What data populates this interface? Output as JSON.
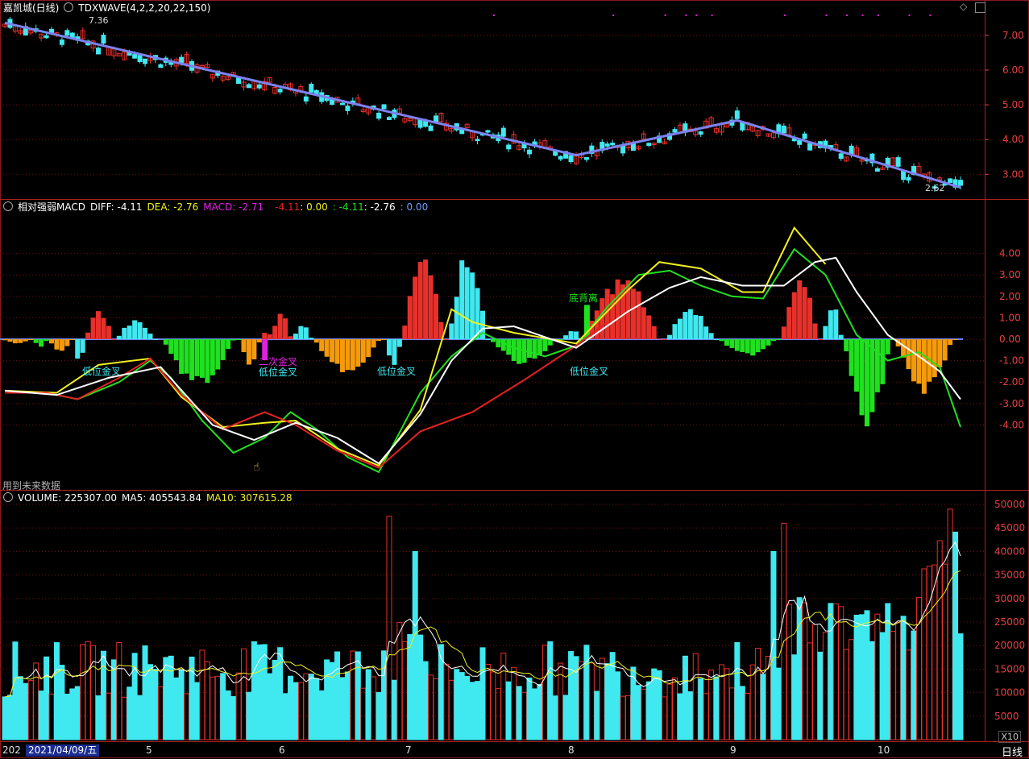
{
  "colors": {
    "up": "#e8302a",
    "down": "#40e8f0",
    "wave": "#7c82f0",
    "grid": "#7a1010",
    "diff_red": "#e82020",
    "dea_white": "#ffffff",
    "yellow": "#f0f020",
    "green": "#20e020",
    "orange": "#f59a0a",
    "magenta": "#e020e0",
    "axis_text": "#e84040"
  },
  "price_panel": {
    "title": "嘉凯城(日线)",
    "indicator": "TDXWAVE(4,2,2,20,22,150)",
    "high_label": "7.36",
    "low_label": "2.62",
    "y_ticks": [
      "7.00",
      "6.00",
      "5.00",
      "4.00",
      "3.00"
    ]
  },
  "macd_panel": {
    "title": "相对强弱MACD",
    "diff_label": "DIFF: -4.11",
    "dea_label": "DEA: -2.76",
    "macd_label": "MACD: -2.71",
    "v1": "-4.11",
    "v2": ": 0.00",
    "v3": ": -4.11",
    "v4": ": -2.76",
    "v5": ": 0.00",
    "y_ticks": [
      "4.00",
      "3.00",
      "2.00",
      "1.00",
      "0.00",
      "-1.00",
      "-2.00",
      "-3.00",
      "-4.00"
    ],
    "annotations": [
      "低位金叉",
      "二次金叉",
      "低位金叉",
      "低位金叉",
      "底背离",
      "低位金叉"
    ],
    "note": "用到未来数据"
  },
  "volume_panel": {
    "title": "VOLUME: 225307.00",
    "ma5": "MA5: 405543.84",
    "ma10": "MA10: 307615.28",
    "y_ticks": [
      "50000",
      "45000",
      "40000",
      "35000",
      "30000",
      "25000",
      "20000",
      "15000",
      "10000",
      "5000"
    ],
    "unit": "X10"
  },
  "xaxis": {
    "first": "202",
    "cursor_date": "2021/04/09/五",
    "months": [
      "5",
      "6",
      "7",
      "8",
      "9",
      "10"
    ],
    "period": "日线"
  },
  "chart_data": [
    {
      "type": "candlestick",
      "title": "嘉凯城(日线)",
      "ylim": [
        2.5,
        7.5
      ],
      "wave_points": [
        [
          0,
          7.36
        ],
        [
          110,
          3.55
        ],
        [
          141,
          4.55
        ],
        [
          184,
          2.62
        ]
      ],
      "note": "Daily price, approx. 185 sessions Apr–Oct 2021; descending from 7.36 to 2.62"
    },
    {
      "type": "bar",
      "title": "相对强弱MACD",
      "ylim": [
        -4.6,
        5.2
      ],
      "diff": -4.11,
      "dea": -2.76,
      "macd": -2.71
    },
    {
      "type": "bar",
      "title": "VOLUME",
      "ylim": [
        0,
        52000
      ],
      "last_volume": 225307.0,
      "ma5": 405543.84,
      "ma10": 307615.28
    }
  ]
}
